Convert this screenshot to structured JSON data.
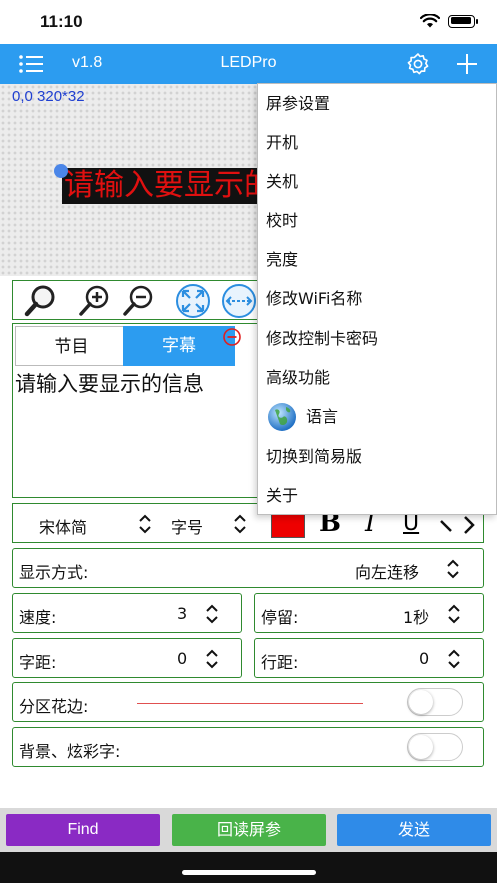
{
  "status_bar": {
    "time": "11:10",
    "wifi_icon": "wifi-icon",
    "battery_icon": "battery-icon"
  },
  "nav": {
    "version": "v1.8",
    "title": "LEDPro",
    "menu_icon": "menu-icon",
    "settings_icon": "gear-icon",
    "add_icon": "plus-icon"
  },
  "preview": {
    "coords": "0,0 320*32",
    "led_text": "请输入要显示的信息",
    "led_color": "#e01010",
    "led_background": "#111111"
  },
  "tabs": {
    "program": "节目",
    "subtitle": "字幕",
    "active": "subtitle"
  },
  "text_content": "请输入要显示的信息",
  "font": {
    "family_value": "宋体简",
    "size_label": "字号",
    "color": "#ee0000",
    "bold": "B",
    "italic": "I",
    "underline": "U"
  },
  "display_mode": {
    "label": "显示方式:",
    "value": "向左连移"
  },
  "speed": {
    "label": "速度:",
    "value": "3"
  },
  "stay": {
    "label": "停留:",
    "value": "1秒"
  },
  "char_spacing": {
    "label": "字距:",
    "value": "0"
  },
  "line_spacing": {
    "label": "行距:",
    "value": "0"
  },
  "zone_border": {
    "label": "分区花边:",
    "enabled": false
  },
  "background": {
    "label": "背景、炫彩字:",
    "enabled": false
  },
  "menu": {
    "items": [
      "屏参设置",
      "开机",
      "关机",
      "校时",
      "亮度",
      "修改WiFi名称",
      "修改控制卡密码",
      "高级功能",
      "语言",
      "切换到简易版",
      "关于"
    ]
  },
  "bottom": {
    "find": "Find",
    "readback": "回读屏参",
    "send": "发送"
  },
  "colors": {
    "accent": "#2c9cf0",
    "border": "#2f8a2f",
    "find": "#8a2ac4",
    "readback": "#49b349",
    "send": "#2f8be8"
  }
}
